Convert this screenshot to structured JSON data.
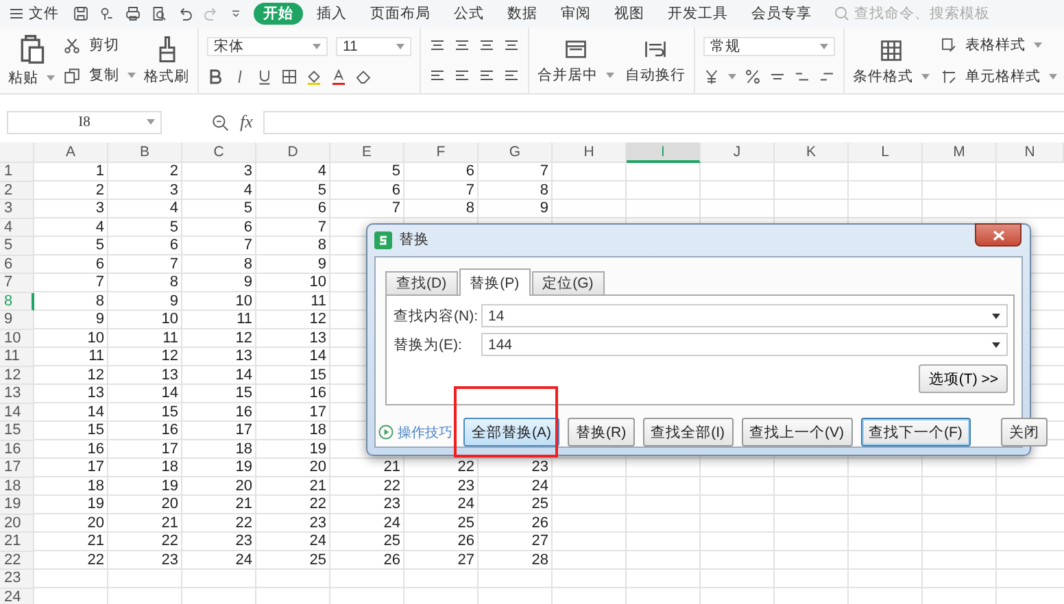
{
  "menu": {
    "file": "文件",
    "tabs": [
      {
        "label": "开始",
        "selected": true
      },
      {
        "label": "插入",
        "selected": false
      },
      {
        "label": "页面布局",
        "selected": false
      },
      {
        "label": "公式",
        "selected": false
      },
      {
        "label": "数据",
        "selected": false
      },
      {
        "label": "审阅",
        "selected": false
      },
      {
        "label": "视图",
        "selected": false
      },
      {
        "label": "开发工具",
        "selected": false
      },
      {
        "label": "会员专享",
        "selected": false
      }
    ],
    "search_placeholder": "查找命令、搜索模板"
  },
  "ribbon": {
    "paste": "粘贴",
    "cut": "剪切",
    "copy": "复制",
    "format_painter": "格式刷",
    "font_name": "宋体",
    "font_size": "11",
    "merge": "合并居中",
    "wrap": "自动换行",
    "number_format": "常规",
    "conditional_format": "条件格式",
    "table_style": "表格样式",
    "cell_style": "单元格样式"
  },
  "formula_bar": {
    "name_box": "I8",
    "fx": "fx"
  },
  "columns": [
    {
      "label": "A",
      "selected": false
    },
    {
      "label": "B",
      "selected": false
    },
    {
      "label": "C",
      "selected": false
    },
    {
      "label": "D",
      "selected": false
    },
    {
      "label": "E",
      "selected": false
    },
    {
      "label": "F",
      "selected": false
    },
    {
      "label": "G",
      "selected": false
    },
    {
      "label": "H",
      "selected": false
    },
    {
      "label": "I",
      "selected": true
    },
    {
      "label": "J",
      "selected": false
    },
    {
      "label": "K",
      "selected": false
    },
    {
      "label": "L",
      "selected": false
    },
    {
      "label": "M",
      "selected": false
    },
    {
      "label": "N",
      "selected": false
    }
  ],
  "rows": [
    {
      "label": "1",
      "selected": false,
      "cells": [
        "1",
        "2",
        "3",
        "4",
        "5",
        "6",
        "7"
      ]
    },
    {
      "label": "2",
      "selected": false,
      "cells": [
        "2",
        "3",
        "4",
        "5",
        "6",
        "7",
        "8"
      ]
    },
    {
      "label": "3",
      "selected": false,
      "cells": [
        "3",
        "4",
        "5",
        "6",
        "7",
        "8",
        "9"
      ]
    },
    {
      "label": "4",
      "selected": false,
      "cells": [
        "4",
        "5",
        "6",
        "7"
      ]
    },
    {
      "label": "5",
      "selected": false,
      "cells": [
        "5",
        "6",
        "7",
        "8"
      ]
    },
    {
      "label": "6",
      "selected": false,
      "cells": [
        "6",
        "7",
        "8",
        "9"
      ]
    },
    {
      "label": "7",
      "selected": false,
      "cells": [
        "7",
        "8",
        "9",
        "10"
      ]
    },
    {
      "label": "8",
      "selected": true,
      "cells": [
        "8",
        "9",
        "10",
        "11"
      ]
    },
    {
      "label": "9",
      "selected": false,
      "cells": [
        "9",
        "10",
        "11",
        "12"
      ]
    },
    {
      "label": "10",
      "selected": false,
      "cells": [
        "10",
        "11",
        "12",
        "13"
      ]
    },
    {
      "label": "11",
      "selected": false,
      "cells": [
        "11",
        "12",
        "13",
        "14"
      ]
    },
    {
      "label": "12",
      "selected": false,
      "cells": [
        "12",
        "13",
        "14",
        "15"
      ]
    },
    {
      "label": "13",
      "selected": false,
      "cells": [
        "13",
        "14",
        "15",
        "16"
      ]
    },
    {
      "label": "14",
      "selected": false,
      "cells": [
        "14",
        "15",
        "16",
        "17"
      ]
    },
    {
      "label": "15",
      "selected": false,
      "cells": [
        "15",
        "16",
        "17",
        "18"
      ]
    },
    {
      "label": "16",
      "selected": false,
      "cells": [
        "16",
        "17",
        "18",
        "19"
      ]
    },
    {
      "label": "17",
      "selected": false,
      "cells": [
        "17",
        "18",
        "19",
        "20",
        "21",
        "22",
        "23"
      ]
    },
    {
      "label": "18",
      "selected": false,
      "cells": [
        "18",
        "19",
        "20",
        "21",
        "22",
        "23",
        "24"
      ]
    },
    {
      "label": "19",
      "selected": false,
      "cells": [
        "19",
        "20",
        "21",
        "22",
        "23",
        "24",
        "25"
      ]
    },
    {
      "label": "20",
      "selected": false,
      "cells": [
        "20",
        "21",
        "22",
        "23",
        "24",
        "25",
        "26"
      ]
    },
    {
      "label": "21",
      "selected": false,
      "cells": [
        "21",
        "22",
        "23",
        "24",
        "25",
        "26",
        "27"
      ]
    },
    {
      "label": "22",
      "selected": false,
      "cells": [
        "22",
        "23",
        "24",
        "25",
        "26",
        "27",
        "28"
      ]
    },
    {
      "label": "23",
      "selected": false,
      "cells": []
    },
    {
      "label": "24",
      "selected": false,
      "cells": []
    }
  ],
  "dialog": {
    "title": "替换",
    "tabs": [
      {
        "label": "查找(D)",
        "selected": false
      },
      {
        "label": "替换(P)",
        "selected": true
      },
      {
        "label": "定位(G)",
        "selected": false
      }
    ],
    "fields": [
      {
        "label": "查找内容(N):",
        "value": "14"
      },
      {
        "label": "替换为(E):",
        "value": "144"
      }
    ],
    "options_button": "选项(T) >>",
    "tips_link": "操作技巧",
    "buttons": [
      {
        "label": "全部替换(A)",
        "hovered": true,
        "focused": false
      },
      {
        "label": "替换(R)",
        "hovered": false,
        "focused": false
      },
      {
        "label": "查找全部(I)",
        "hovered": false,
        "focused": false
      },
      {
        "label": "查找上一个(V)",
        "hovered": false,
        "focused": false
      },
      {
        "label": "查找下一个(F)",
        "hovered": false,
        "focused": true
      }
    ],
    "close_button": "关闭"
  }
}
